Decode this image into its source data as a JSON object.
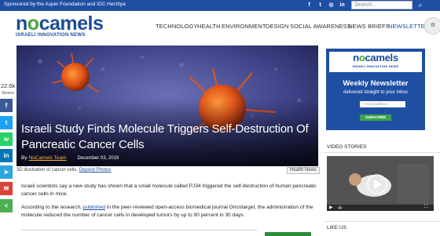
{
  "topbar": {
    "sponsor": "Sponsored by the Asper Foundation and IDC Herzliya",
    "search_placeholder": "Search...",
    "social_icons": [
      "facebook-icon",
      "twitter-icon",
      "instagram-icon",
      "linkedin-icon",
      "email-icon"
    ]
  },
  "logo": {
    "word_pre": "n",
    "word_o": "o",
    "word_post": "camels",
    "tagline": "ISRAELI INNOVATION NEWS"
  },
  "nav": {
    "items": [
      "TECHNOLOGY",
      "HEALTH",
      "ENVIRONMENT",
      "DESIGN",
      "SOCIAL AWARENESS",
      "NEWS BRIEFS",
      "NEWSLETTER"
    ],
    "active_index": 6
  },
  "share": {
    "count": "22.6k",
    "label": "Shares",
    "buttons": [
      {
        "icon": "facebook-icon",
        "glyph": "f",
        "color": "#3b5998"
      },
      {
        "icon": "twitter-icon",
        "glyph": "t",
        "color": "#1da1f2"
      },
      {
        "icon": "whatsapp-icon",
        "glyph": "w",
        "color": "#25d366"
      },
      {
        "icon": "linkedin-icon",
        "glyph": "in",
        "color": "#0077b5"
      },
      {
        "icon": "telegram-icon",
        "glyph": "➤",
        "color": "#2ca5e0"
      },
      {
        "icon": "email-icon",
        "glyph": "✉",
        "color": "#d9433b"
      },
      {
        "icon": "share-icon",
        "glyph": "<",
        "color": "#4caf50"
      }
    ]
  },
  "article": {
    "headline": "Israeli Study Finds Molecule Triggers Self-Destruction Of Pancreatic Cancer Cells",
    "by": "By",
    "author": "NoCamels Team",
    "date": "December 03, 2019",
    "caption_text": "3D illustration of cancer cells.",
    "caption_credit": "Deposit Photos",
    "category": "Health News",
    "p1": "Israeli scientists say a new study has shown that a small molecule called PJ34 triggered the self-destruction of human pancreatic cancer cells in mice.",
    "p2_pre": "According to the research,",
    "p2_link": "published",
    "p2_post": "in the peer-reviewed open-access biomedical journal Oncotarget, the administration of the molecule reduced the number of cancer cells in developed tumors by up to 90 percent in 30 days."
  },
  "newsletter": {
    "logo_tagline": "ISRAELI INNOVATION NEWS",
    "title": "Weekly Newsletter",
    "subtitle": "delivered straight to your inbox",
    "email_placeholder": "* email address",
    "button": "SUBSCRIBE"
  },
  "sidebar": {
    "video_stories": "VIDEO STORIES",
    "like_us": "LIKE US"
  },
  "colors": {
    "brand_blue": "#1f4fa3",
    "brand_green": "#4aa33c",
    "link_orange": "#ffb14a"
  }
}
